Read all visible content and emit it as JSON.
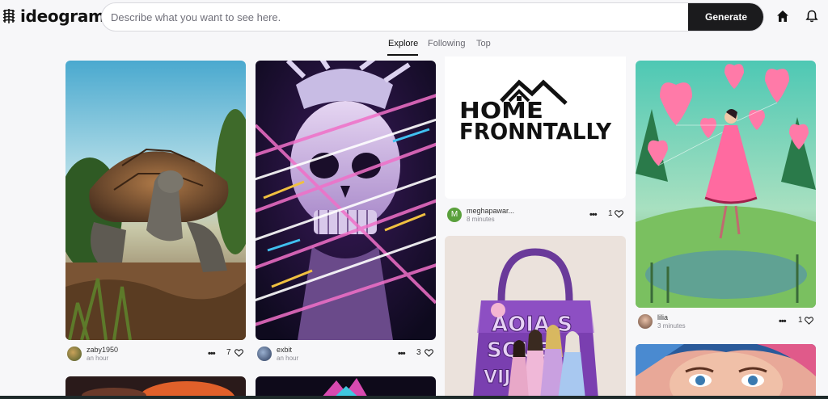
{
  "app": {
    "logo_text": "ideogram"
  },
  "search": {
    "placeholder": "Describe what you want to see here.",
    "value": ""
  },
  "actions": {
    "generate_label": "Generate"
  },
  "tabs": [
    {
      "label": "Explore",
      "active": true
    },
    {
      "label": "Following",
      "active": false
    },
    {
      "label": "Top",
      "active": false
    }
  ],
  "cards": [
    {
      "image": "Giant tortoise walking on dirt path",
      "user": "zaby1950",
      "time": "an hour",
      "likes": "7"
    },
    {
      "image": "Neon skull portrait with glowing light streaks",
      "user": "exbit",
      "time": "an hour",
      "likes": "3"
    },
    {
      "image": "Home Fronntally logo",
      "user": "meghapawar...",
      "time": "8 minutes",
      "likes": "1",
      "avatar_letter": "M"
    },
    {
      "image": "Purple handbag with dolls",
      "user": "",
      "time": "",
      "likes": ""
    },
    {
      "image": "Girl in pink dress with heart balloons",
      "user": "lilia",
      "time": "3 minutes",
      "likes": "1"
    },
    {
      "image": "Colorful woman portrait painting",
      "user": "",
      "time": "",
      "likes": ""
    }
  ],
  "logo_card": {
    "line1": "HOME",
    "line2": "FRONNTALLY"
  },
  "bag_card": {
    "line1": "AOIA S",
    "line2": "SQUE",
    "line3": "VIJI"
  },
  "colors": {
    "accent": "#1b1b1d",
    "background": "#f7f7f9",
    "avatar_green": "#5aa03c"
  }
}
